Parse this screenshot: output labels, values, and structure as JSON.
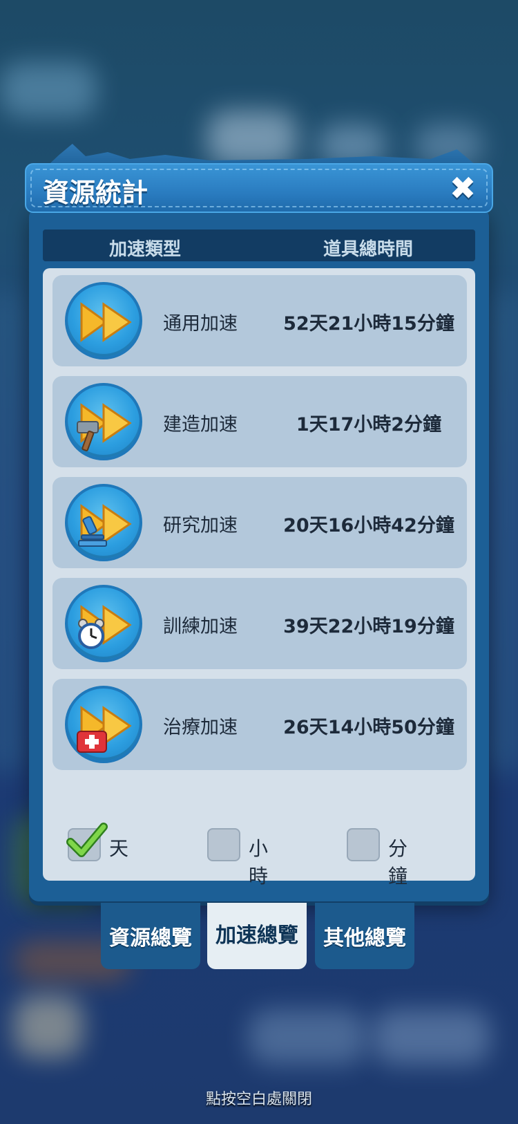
{
  "title": "資源統計",
  "close_symbol": "✖",
  "columns": {
    "type": "加速類型",
    "time": "道具總時間"
  },
  "rows": [
    {
      "label": "通用加速",
      "value": "52天21小時15分鐘",
      "icon": "fast-forward-icon"
    },
    {
      "label": "建造加速",
      "value": "1天17小時2分鐘",
      "icon": "hammer-icon"
    },
    {
      "label": "研究加速",
      "value": "20天16小時42分鐘",
      "icon": "microscope-icon"
    },
    {
      "label": "訓練加速",
      "value": "39天22小時19分鐘",
      "icon": "alarm-clock-icon"
    },
    {
      "label": "治療加速",
      "value": "26天14小時50分鐘",
      "icon": "first-aid-kit-icon"
    }
  ],
  "units": [
    {
      "label": "天",
      "checked": true
    },
    {
      "label": "小時",
      "checked": false
    },
    {
      "label": "分鐘",
      "checked": false
    }
  ],
  "tabs": [
    {
      "label": "資源總覽",
      "active": false
    },
    {
      "label": "加速總覽",
      "active": true
    },
    {
      "label": "其他總覽",
      "active": false
    }
  ],
  "hint": "點按空白處關閉",
  "colors": {
    "accent": "#2a7cc0",
    "row_bg": "#b3c8db",
    "panel_bg": "#1c5f96",
    "arrow": "#f5b82a"
  }
}
